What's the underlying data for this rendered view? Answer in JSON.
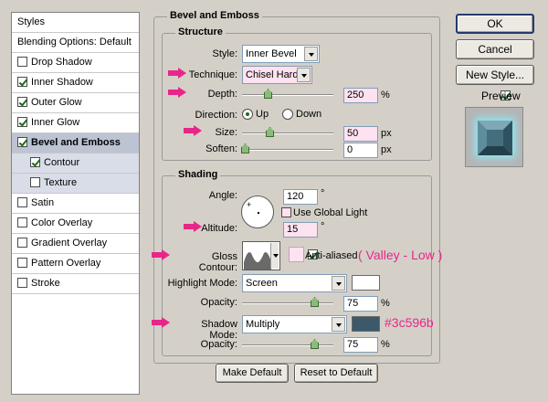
{
  "colors": {
    "annotation": "#e8268a",
    "shadow_swatch": "#3c596b",
    "highlight_swatch": "#ffffff"
  },
  "styles_panel": {
    "header": "Styles",
    "blending": "Blending Options: Default",
    "items": [
      {
        "label": "Drop Shadow",
        "checked": false
      },
      {
        "label": "Inner Shadow",
        "checked": true
      },
      {
        "label": "Outer Glow",
        "checked": true
      },
      {
        "label": "Inner Glow",
        "checked": true
      },
      {
        "label": "Bevel and Emboss",
        "checked": true,
        "selected": true
      },
      {
        "label": "Contour",
        "checked": true
      },
      {
        "label": "Texture",
        "checked": false
      },
      {
        "label": "Satin",
        "checked": false
      },
      {
        "label": "Color Overlay",
        "checked": false
      },
      {
        "label": "Gradient Overlay",
        "checked": false
      },
      {
        "label": "Pattern Overlay",
        "checked": false
      },
      {
        "label": "Stroke",
        "checked": false
      }
    ]
  },
  "bevel": {
    "title": "Bevel and Emboss",
    "structure": {
      "title": "Structure",
      "style_label": "Style:",
      "style_value": "Inner Bevel",
      "technique_label": "Technique:",
      "technique_value": "Chisel Hard",
      "depth_label": "Depth:",
      "depth_value": "250",
      "depth_unit": "%",
      "direction_label": "Direction:",
      "dir_up": "Up",
      "dir_down": "Down",
      "size_label": "Size:",
      "size_value": "50",
      "size_unit": "px",
      "soften_label": "Soften:",
      "soften_value": "0",
      "soften_unit": "px"
    },
    "shading": {
      "title": "Shading",
      "angle_label": "Angle:",
      "angle_value": "120",
      "angle_unit": "°",
      "global_light": "Use Global Light",
      "altitude_label": "Altitude:",
      "altitude_value": "15",
      "altitude_unit": "°",
      "gloss_label": "Gloss Contour:",
      "anti_aliased": "Anti-aliased",
      "gloss_note": "( Valley - Low )",
      "highlight_mode_label": "Highlight Mode:",
      "highlight_mode_value": "Screen",
      "highlight_opacity_label": "Opacity:",
      "highlight_opacity_value": "75",
      "shadow_mode_label": "Shadow Mode:",
      "shadow_mode_value": "Multiply",
      "shadow_color_note": "#3c596b",
      "shadow_opacity_label": "Opacity:",
      "shadow_opacity_value": "75",
      "percent": "%"
    },
    "make_default": "Make Default",
    "reset_default": "Reset to Default"
  },
  "buttons": {
    "ok": "OK",
    "cancel": "Cancel",
    "new_style": "New Style...",
    "preview": "Preview"
  }
}
